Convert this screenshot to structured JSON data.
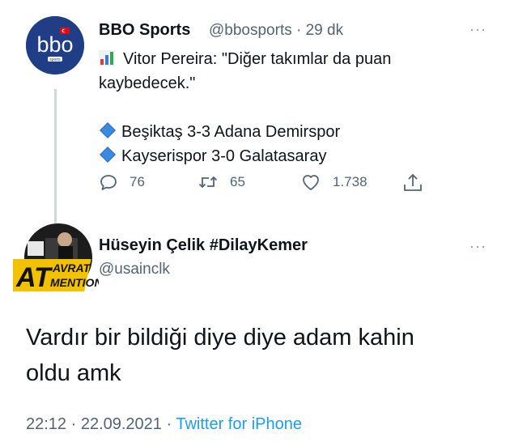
{
  "tweet1": {
    "avatar_text": "bbo",
    "avatar_subtext": "sports",
    "display_name": "BBO Sports",
    "handle_time": "@bbosports · 29 dk",
    "more": "···",
    "text_line1": "Vitor Pereira: \"Diğer takımlar da puan",
    "text_line2": "kaybedecek.\"",
    "result1": "Beşiktaş 3-3 Adana Demirspor",
    "result2": "Kayserispor 3-0 Galatasaray",
    "replies": "76",
    "retweets": "65",
    "likes": "1.738"
  },
  "tweet2": {
    "display_name": "Hüseyin Çelik #DilayKemer",
    "handle": "@usainclk",
    "more": "···",
    "avatar_logo_main": "AT",
    "avatar_logo_top": "AVRAT",
    "avatar_logo_bottom": "MENTION",
    "text_line1": "Vardır bir bildiği diye diye adam kahin",
    "text_line2": "oldu amk",
    "time_date": "22:12 · 22.09.2021 · ",
    "source": "Twitter for iPhone"
  },
  "colors": {
    "accent": "#1d9bf0",
    "secondary_text": "#536471",
    "avatar_bg": "#1f3e85"
  }
}
